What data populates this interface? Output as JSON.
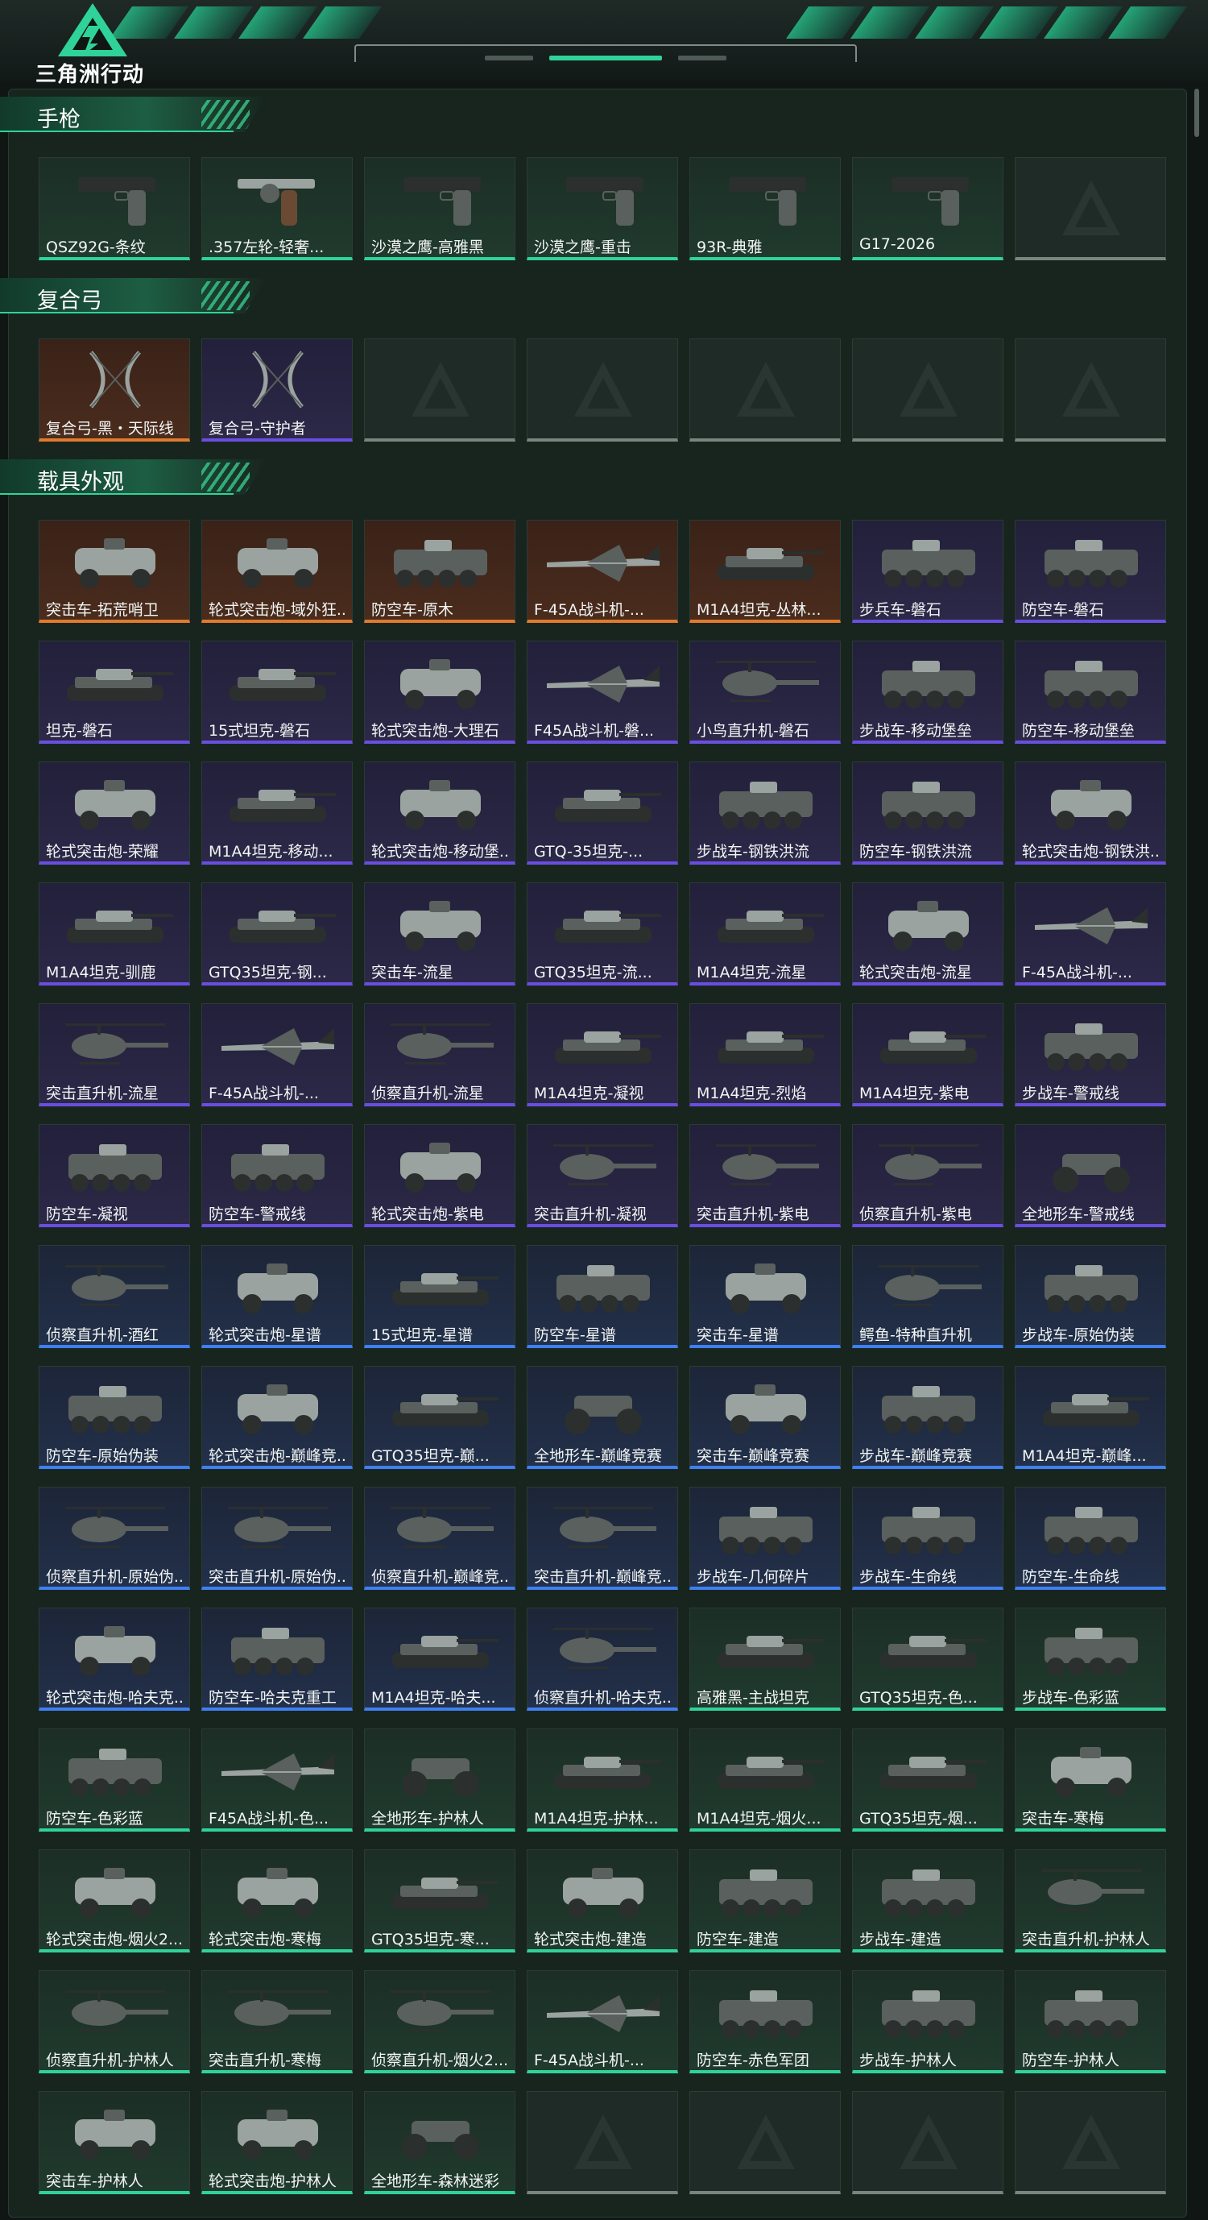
{
  "header": {
    "logo_text": "三角洲行动"
  },
  "colors": {
    "accent": "#2fd39a",
    "orange": "#e07a2c",
    "purple": "#6a4ee0",
    "blue": "#3f7ff0",
    "green": "#2fd39a",
    "empty": "#7a8581"
  },
  "sections": [
    {
      "title": "手枪",
      "items": [
        {
          "label": "QSZ92G-条纹",
          "rarity": "green",
          "icon": "pistol-icon"
        },
        {
          "label": ".357左轮-轻奢...",
          "rarity": "green",
          "icon": "revolver-icon"
        },
        {
          "label": "沙漠之鹰-高雅黑",
          "rarity": "green",
          "icon": "pistol-icon"
        },
        {
          "label": "沙漠之鹰-重击",
          "rarity": "green",
          "icon": "pistol-icon"
        },
        {
          "label": "93R-典雅",
          "rarity": "green",
          "icon": "pistol-icon"
        },
        {
          "label": "G17-2026",
          "rarity": "green",
          "icon": "pistol-icon"
        },
        {
          "label": "",
          "rarity": "empty",
          "icon": "empty-slot-icon"
        }
      ]
    },
    {
      "title": "复合弓",
      "items": [
        {
          "label": "复合弓-黑・天际线",
          "rarity": "orange",
          "icon": "bow-icon"
        },
        {
          "label": "复合弓-守护者",
          "rarity": "purple",
          "icon": "bow-icon"
        },
        {
          "label": "",
          "rarity": "empty",
          "icon": "empty-slot-icon"
        },
        {
          "label": "",
          "rarity": "empty",
          "icon": "empty-slot-icon"
        },
        {
          "label": "",
          "rarity": "empty",
          "icon": "empty-slot-icon"
        },
        {
          "label": "",
          "rarity": "empty",
          "icon": "empty-slot-icon"
        },
        {
          "label": "",
          "rarity": "empty",
          "icon": "empty-slot-icon"
        }
      ]
    },
    {
      "title": "载具外观",
      "items": [
        {
          "label": "突击车-拓荒哨卫",
          "rarity": "orange",
          "icon": "armored-car-icon"
        },
        {
          "label": "轮式突击炮-域外狂...",
          "rarity": "orange",
          "icon": "armored-car-icon"
        },
        {
          "label": "防空车-原木",
          "rarity": "orange",
          "icon": "apc-icon"
        },
        {
          "label": "F-45A战斗机-...",
          "rarity": "orange",
          "icon": "jet-icon"
        },
        {
          "label": "M1A4坦克-丛林...",
          "rarity": "orange",
          "icon": "tank-icon"
        },
        {
          "label": "步兵车-磐石",
          "rarity": "purple",
          "icon": "apc-icon"
        },
        {
          "label": "防空车-磐石",
          "rarity": "purple",
          "icon": "apc-icon"
        },
        {
          "label": "坦克-磐石",
          "rarity": "purple",
          "icon": "tank-icon"
        },
        {
          "label": "15式坦克-磐石",
          "rarity": "purple",
          "icon": "tank-icon"
        },
        {
          "label": "轮式突击炮-大理石",
          "rarity": "purple",
          "icon": "armored-car-icon"
        },
        {
          "label": "F45A战斗机-磐...",
          "rarity": "purple",
          "icon": "jet-icon"
        },
        {
          "label": "小鸟直升机-磐石",
          "rarity": "purple",
          "icon": "helicopter-icon"
        },
        {
          "label": "步战车-移动堡垒",
          "rarity": "purple",
          "icon": "apc-icon"
        },
        {
          "label": "防空车-移动堡垒",
          "rarity": "purple",
          "icon": "apc-icon"
        },
        {
          "label": "轮式突击炮-荣耀",
          "rarity": "purple",
          "icon": "armored-car-icon"
        },
        {
          "label": "M1A4坦克-移动...",
          "rarity": "purple",
          "icon": "tank-icon"
        },
        {
          "label": "轮式突击炮-移动堡...",
          "rarity": "purple",
          "icon": "armored-car-icon"
        },
        {
          "label": "GTQ-35坦克-...",
          "rarity": "purple",
          "icon": "tank-icon"
        },
        {
          "label": "步战车-钢铁洪流",
          "rarity": "purple",
          "icon": "apc-icon"
        },
        {
          "label": "防空车-钢铁洪流",
          "rarity": "purple",
          "icon": "apc-icon"
        },
        {
          "label": "轮式突击炮-钢铁洪...",
          "rarity": "purple",
          "icon": "armored-car-icon"
        },
        {
          "label": "M1A4坦克-驯鹿",
          "rarity": "purple",
          "icon": "tank-icon"
        },
        {
          "label": "GTQ35坦克-钢...",
          "rarity": "purple",
          "icon": "tank-icon"
        },
        {
          "label": "突击车-流星",
          "rarity": "purple",
          "icon": "armored-car-icon"
        },
        {
          "label": "GTQ35坦克-流...",
          "rarity": "purple",
          "icon": "tank-icon"
        },
        {
          "label": "M1A4坦克-流星",
          "rarity": "purple",
          "icon": "tank-icon"
        },
        {
          "label": "轮式突击炮-流星",
          "rarity": "purple",
          "icon": "armored-car-icon"
        },
        {
          "label": "F-45A战斗机-...",
          "rarity": "purple",
          "icon": "jet-icon"
        },
        {
          "label": "突击直升机-流星",
          "rarity": "purple",
          "icon": "helicopter-icon"
        },
        {
          "label": "F-45A战斗机-...",
          "rarity": "purple",
          "icon": "jet-icon"
        },
        {
          "label": "侦察直升机-流星",
          "rarity": "purple",
          "icon": "helicopter-icon"
        },
        {
          "label": "M1A4坦克-凝视",
          "rarity": "purple",
          "icon": "tank-icon"
        },
        {
          "label": "M1A4坦克-烈焰",
          "rarity": "purple",
          "icon": "tank-icon"
        },
        {
          "label": "M1A4坦克-紫电",
          "rarity": "purple",
          "icon": "tank-icon"
        },
        {
          "label": "步战车-警戒线",
          "rarity": "purple",
          "icon": "apc-icon"
        },
        {
          "label": "防空车-凝视",
          "rarity": "purple",
          "icon": "apc-icon"
        },
        {
          "label": "防空车-警戒线",
          "rarity": "purple",
          "icon": "apc-icon"
        },
        {
          "label": "轮式突击炮-紫电",
          "rarity": "purple",
          "icon": "armored-car-icon"
        },
        {
          "label": "突击直升机-凝视",
          "rarity": "purple",
          "icon": "helicopter-icon"
        },
        {
          "label": "突击直升机-紫电",
          "rarity": "purple",
          "icon": "helicopter-icon"
        },
        {
          "label": "侦察直升机-紫电",
          "rarity": "purple",
          "icon": "helicopter-icon"
        },
        {
          "label": "全地形车-警戒线",
          "rarity": "purple",
          "icon": "atv-icon"
        },
        {
          "label": "侦察直升机-酒红",
          "rarity": "blue",
          "icon": "helicopter-icon"
        },
        {
          "label": "轮式突击炮-星谱",
          "rarity": "blue",
          "icon": "armored-car-icon"
        },
        {
          "label": "15式坦克-星谱",
          "rarity": "blue",
          "icon": "tank-icon"
        },
        {
          "label": "防空车-星谱",
          "rarity": "blue",
          "icon": "apc-icon"
        },
        {
          "label": "突击车-星谱",
          "rarity": "blue",
          "icon": "armored-car-icon"
        },
        {
          "label": "鳄鱼-特种直升机",
          "rarity": "blue",
          "icon": "helicopter-icon"
        },
        {
          "label": "步战车-原始伪装",
          "rarity": "blue",
          "icon": "apc-icon"
        },
        {
          "label": "防空车-原始伪装",
          "rarity": "blue",
          "icon": "apc-icon"
        },
        {
          "label": "轮式突击炮-巅峰竞...",
          "rarity": "blue",
          "icon": "armored-car-icon"
        },
        {
          "label": "GTQ35坦克-巅...",
          "rarity": "blue",
          "icon": "tank-icon"
        },
        {
          "label": "全地形车-巅峰竞赛",
          "rarity": "blue",
          "icon": "atv-icon"
        },
        {
          "label": "突击车-巅峰竞赛",
          "rarity": "blue",
          "icon": "armored-car-icon"
        },
        {
          "label": "步战车-巅峰竞赛",
          "rarity": "blue",
          "icon": "apc-icon"
        },
        {
          "label": "M1A4坦克-巅峰...",
          "rarity": "blue",
          "icon": "tank-icon"
        },
        {
          "label": "侦察直升机-原始伪...",
          "rarity": "blue",
          "icon": "helicopter-icon"
        },
        {
          "label": "突击直升机-原始伪...",
          "rarity": "blue",
          "icon": "helicopter-icon"
        },
        {
          "label": "侦察直升机-巅峰竞...",
          "rarity": "blue",
          "icon": "helicopter-icon"
        },
        {
          "label": "突击直升机-巅峰竞...",
          "rarity": "blue",
          "icon": "helicopter-icon"
        },
        {
          "label": "步战车-几何碎片",
          "rarity": "blue",
          "icon": "apc-icon"
        },
        {
          "label": "步战车-生命线",
          "rarity": "blue",
          "icon": "apc-icon"
        },
        {
          "label": "防空车-生命线",
          "rarity": "blue",
          "icon": "apc-icon"
        },
        {
          "label": "轮式突击炮-哈夫克...",
          "rarity": "blue",
          "icon": "armored-car-icon"
        },
        {
          "label": "防空车-哈夫克重工",
          "rarity": "blue",
          "icon": "apc-icon"
        },
        {
          "label": "M1A4坦克-哈夫...",
          "rarity": "blue",
          "icon": "tank-icon"
        },
        {
          "label": "侦察直升机-哈夫克...",
          "rarity": "blue",
          "icon": "helicopter-icon"
        },
        {
          "label": "高雅黑-主战坦克",
          "rarity": "green",
          "icon": "tank-icon"
        },
        {
          "label": "GTQ35坦克-色...",
          "rarity": "green",
          "icon": "tank-icon"
        },
        {
          "label": "步战车-色彩蓝",
          "rarity": "green",
          "icon": "apc-icon"
        },
        {
          "label": "防空车-色彩蓝",
          "rarity": "green",
          "icon": "apc-icon"
        },
        {
          "label": "F45A战斗机-色...",
          "rarity": "green",
          "icon": "jet-icon"
        },
        {
          "label": "全地形车-护林人",
          "rarity": "green",
          "icon": "atv-icon"
        },
        {
          "label": "M1A4坦克-护林...",
          "rarity": "green",
          "icon": "tank-icon"
        },
        {
          "label": "M1A4坦克-烟火...",
          "rarity": "green",
          "icon": "tank-icon"
        },
        {
          "label": "GTQ35坦克-烟...",
          "rarity": "green",
          "icon": "tank-icon"
        },
        {
          "label": "突击车-寒梅",
          "rarity": "green",
          "icon": "armored-car-icon"
        },
        {
          "label": "轮式突击炮-烟火2...",
          "rarity": "green",
          "icon": "armored-car-icon"
        },
        {
          "label": "轮式突击炮-寒梅",
          "rarity": "green",
          "icon": "armored-car-icon"
        },
        {
          "label": "GTQ35坦克-寒...",
          "rarity": "green",
          "icon": "tank-icon"
        },
        {
          "label": "轮式突击炮-建造",
          "rarity": "green",
          "icon": "armored-car-icon"
        },
        {
          "label": "防空车-建造",
          "rarity": "green",
          "icon": "apc-icon"
        },
        {
          "label": "步战车-建造",
          "rarity": "green",
          "icon": "apc-icon"
        },
        {
          "label": "突击直升机-护林人",
          "rarity": "green",
          "icon": "helicopter-icon"
        },
        {
          "label": "侦察直升机-护林人",
          "rarity": "green",
          "icon": "helicopter-icon"
        },
        {
          "label": "突击直升机-寒梅",
          "rarity": "green",
          "icon": "helicopter-icon"
        },
        {
          "label": "侦察直升机-烟火2...",
          "rarity": "green",
          "icon": "helicopter-icon"
        },
        {
          "label": "F-45A战斗机-...",
          "rarity": "green",
          "icon": "jet-icon"
        },
        {
          "label": "防空车-赤色军团",
          "rarity": "green",
          "icon": "apc-icon"
        },
        {
          "label": "步战车-护林人",
          "rarity": "green",
          "icon": "apc-icon"
        },
        {
          "label": "防空车-护林人",
          "rarity": "green",
          "icon": "apc-icon"
        },
        {
          "label": "突击车-护林人",
          "rarity": "green",
          "icon": "armored-car-icon"
        },
        {
          "label": "轮式突击炮-护林人",
          "rarity": "green",
          "icon": "armored-car-icon"
        },
        {
          "label": "全地形车-森林迷彩",
          "rarity": "green",
          "icon": "atv-icon"
        },
        {
          "label": "",
          "rarity": "empty",
          "icon": "empty-slot-icon"
        },
        {
          "label": "",
          "rarity": "empty",
          "icon": "empty-slot-icon"
        },
        {
          "label": "",
          "rarity": "empty",
          "icon": "empty-slot-icon"
        },
        {
          "label": "",
          "rarity": "empty",
          "icon": "empty-slot-icon"
        }
      ]
    }
  ]
}
